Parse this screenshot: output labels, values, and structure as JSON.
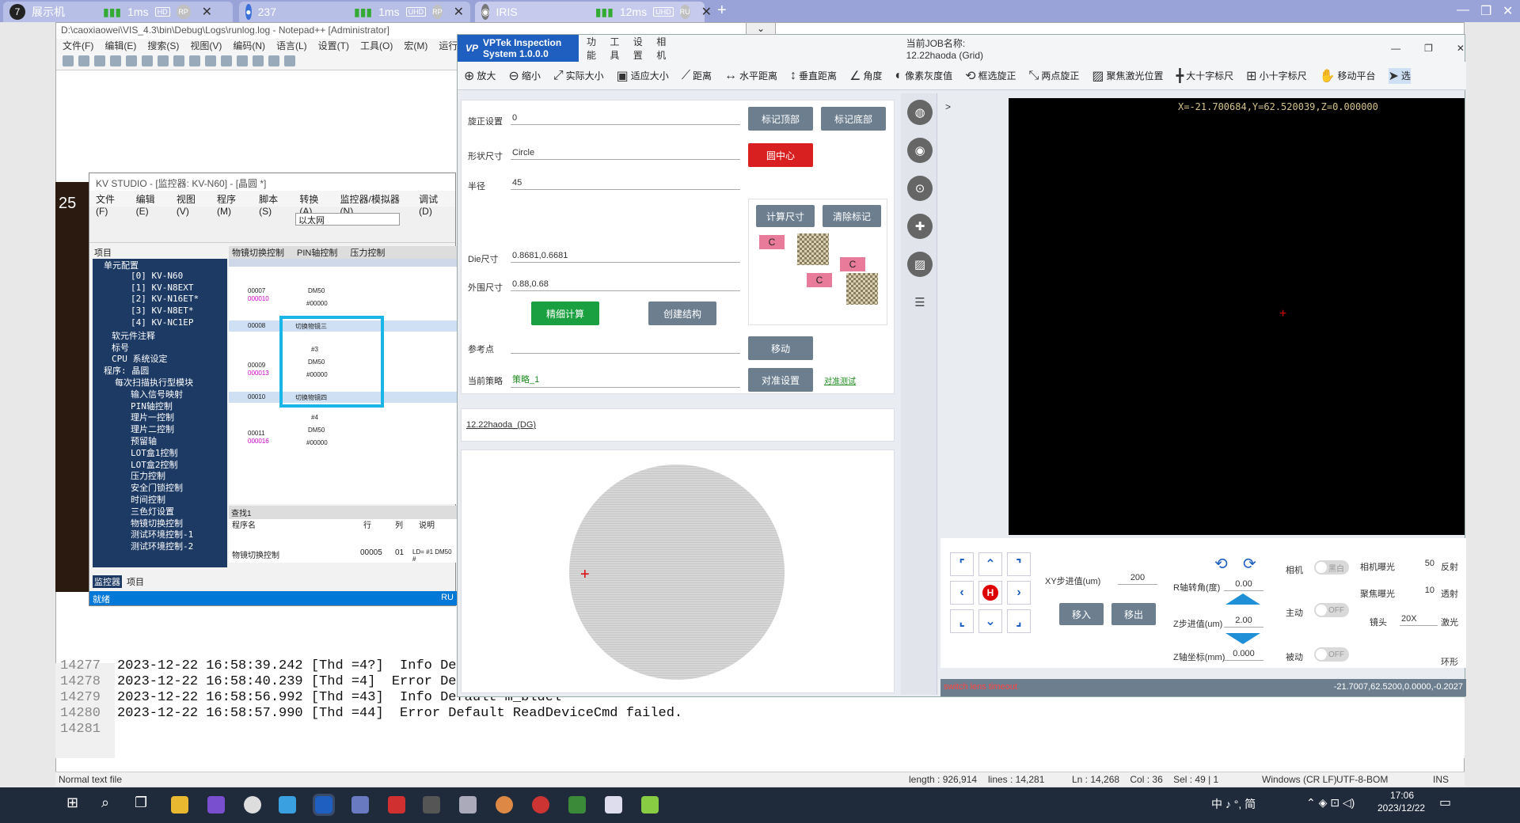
{
  "browser": {
    "tabs": [
      {
        "label": "展示机",
        "latency": "1ms",
        "badge": "HD",
        "bp": "RP"
      },
      {
        "label": "237",
        "latency": "1ms",
        "badge": "UHD",
        "bp": "RP"
      },
      {
        "label": "IRIS",
        "latency": "12ms",
        "badge": "UHD",
        "bp": "RU"
      }
    ],
    "new_tab": "+",
    "dropdown": "⌄"
  },
  "notepad": {
    "title": "D:\\caoxiaowei\\VIS_4.3\\bin\\Debug\\Logs\\runlog.log - Notepad++ [Administrator]",
    "menu": [
      "文件(F)",
      "编辑(E)",
      "搜索(S)",
      "视图(V)",
      "编码(N)",
      "语言(L)",
      "设置(T)",
      "工具(O)",
      "宏(M)",
      "运行(R)",
      "插"
    ],
    "lines": [
      {
        "num": "14277",
        "text": "2023-12-22 16:58:39.242 [Thd =4?]  Info De"
      },
      {
        "num": "14278",
        "text": "2023-12-22 16:58:40.239 [Thd =4]  Error De"
      },
      {
        "num": "14279",
        "text": "2023-12-22 16:58:56.992 [Thd =43]  Info Default m_bldel"
      },
      {
        "num": "14280",
        "text": "2023-12-22 16:58:57.990 [Thd =44]  Error Default ReadDeviceCmd failed."
      },
      {
        "num": "14281",
        "text": ""
      }
    ],
    "status": {
      "type": "Normal text file",
      "length": "length : 926,914",
      "lines": "lines : 14,281",
      "pos": "Ln : 14,268    Col : 36    Sel : 49 | 1",
      "eol": "Windows (CR LF)",
      "enc": "UTF-8-BOM",
      "mode": "INS"
    }
  },
  "kv": {
    "title": "KV STUDIO - [监控器: KV-N60] - [晶圆 *]",
    "menu": [
      "文件(F)",
      "编辑(E)",
      "视图(V)",
      "程序(M)",
      "脚本(S)",
      "转换(A)",
      "监控器/模拟器(N)",
      "调试(D)"
    ],
    "network": "以太网",
    "project_header": "项目",
    "tree": [
      "单元配置",
      "[0] KV-N60",
      "[1] KV-N8EXT",
      "[2] KV-N16ET*",
      "[3] KV-N8ET*",
      "[4] KV-NC1EP",
      "软元件注释",
      "标号",
      "CPU 系统设定",
      "程序: 晶圆",
      "每次扫描执行型模块",
      "输入信号映射",
      "PIN轴控制",
      "理片一控制",
      "理片二控制",
      "预留轴",
      "LOT盒1控制",
      "LOT盒2控制",
      "压力控制",
      "安全门锁控制",
      "时间控制",
      "三色灯设置",
      "物镜切换控制",
      "测试环境控制-1",
      "测试环境控制-2"
    ],
    "tabs": [
      "物镜切换控制",
      "PIN轴控制",
      "压力控制"
    ],
    "rungs": [
      {
        "addr": "00007",
        "sub": "000010",
        "dm": "DM50",
        "val": "#00000"
      },
      {
        "addr": "00008",
        "comment": "切换物镜三"
      },
      {
        "addr": "00009",
        "sub": "000013",
        "num": "#3",
        "dm": "DM50",
        "val": "#00000"
      },
      {
        "addr": "00010",
        "comment": "切换物镜四"
      },
      {
        "addr": "00011",
        "sub": "000016",
        "num": "#4",
        "dm": "DM50",
        "val": "#00000"
      }
    ],
    "search_header": "查找1",
    "search_cols": [
      "程序名",
      "行",
      "列",
      "说明"
    ],
    "search_row": [
      "物镜切换控制",
      "00005",
      "01",
      "LD= #1 DM50 #"
    ],
    "bottom_tabs": [
      "监控器",
      "项目"
    ],
    "status": "就绪",
    "status_right": "RU"
  },
  "vis": {
    "brand": "VPTek Inspection System 1.0.0.0",
    "menu": [
      "功能",
      "工具",
      "设置",
      "相机"
    ],
    "job": "当前JOB名称: 12.22haoda (Grid)",
    "tools": [
      "放大",
      "缩小",
      "实际大小",
      "适应大小",
      "距离",
      "水平距离",
      "垂直距离",
      "角度",
      "像素灰度值",
      "框选旋正",
      "两点旋正",
      "聚焦激光位置",
      "大十字标尺",
      "小十字标尺",
      "移动平台",
      "选"
    ],
    "rotation_label": "旋正设置",
    "rotation_value": "0",
    "mark_top": "标记顶部",
    "mark_bottom": "标记底部",
    "shape_label": "形状尺寸",
    "shape_value": "Circle",
    "circle_center": "圆中心",
    "radius_label": "半径",
    "radius_value": "45",
    "calc_size": "计算尺寸",
    "clear_mark": "清除标记",
    "die_label": "Die尺寸",
    "die_value": "0.8681,0.6681",
    "outer_label": "外围尺寸",
    "outer_value": "0.88,0.68",
    "fine_calc": "精细计算",
    "create_struct": "创建结构",
    "ref_label": "参考点",
    "move": "移动",
    "strategy_label": "当前策略",
    "strategy_value": "策略_1",
    "align_set": "对准设置",
    "align_test": "对准测试",
    "job_link": "12.22haoda_(DG)",
    "coords": "X=-21.700684,Y=62.520039,Z=0.000000",
    "xy_step_label": "XY步进值(um)",
    "xy_step": "200",
    "r_angle_label": "R轴转角(度)",
    "r_angle": "0.00",
    "z_step_label": "Z步进值(um)",
    "z_step": "2.00",
    "z_coord_label": "Z轴坐标(mm)",
    "z_coord": "0.000",
    "move_in": "移入",
    "move_out": "移出",
    "camera_label": "相机",
    "camera_toggle": "黑白",
    "active_label": "主动",
    "active_toggle": "OFF",
    "passive_label": "被动",
    "passive_toggle": "OFF",
    "cam_exposure_label": "相机曝光",
    "cam_exposure": "50",
    "focus_exposure_label": "聚焦曝光",
    "focus_exposure": "10",
    "lens_label": "镜头",
    "lens": "20X",
    "reflect": "反射",
    "transmit": "透射",
    "laser": "激光",
    "ring": "环形",
    "status_left": "switch lens timeout",
    "status_right": "-21.7007,62.5200,0.0000,-0.2027",
    "c_marker": "C",
    "h_marker": "H"
  },
  "left_clock": "25",
  "taskbar": {
    "ime": "中 ♪ °, 简",
    "time": "17:06",
    "date": "2023/12/22"
  }
}
